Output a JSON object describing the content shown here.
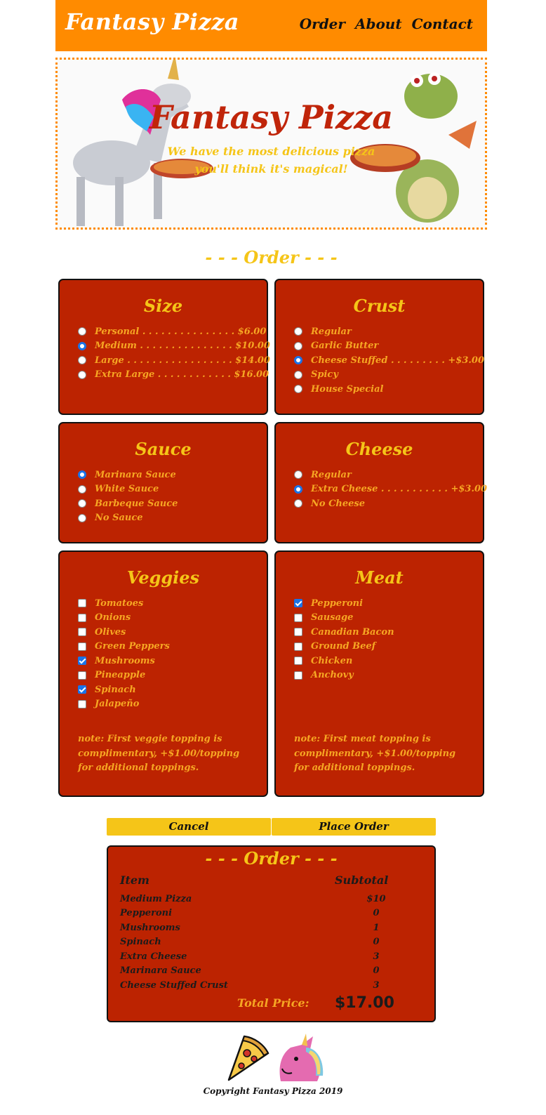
{
  "header": {
    "brand": "Fantasy Pizza",
    "nav": [
      "Order",
      "About",
      "Contact"
    ]
  },
  "hero": {
    "title": "Fantasy Pizza",
    "subtitle_line1": "We have the most delicious pizza",
    "subtitle_line2": "you'll think it's magical!"
  },
  "order_title": "- - - Order - - -",
  "size": {
    "title": "Size",
    "options": [
      {
        "label": "Personal . . . . . . . . . . . . . . . $6.00",
        "selected": false
      },
      {
        "label": "Medium . . . . . . . . . . . . . . . $10.00",
        "selected": true
      },
      {
        "label": "Large . . . . . . . . . . . . . . . . . $14.00",
        "selected": false
      },
      {
        "label": "Extra Large . . . . . . . . . . . . $16.00",
        "selected": false
      }
    ]
  },
  "crust": {
    "title": "Crust",
    "options": [
      {
        "label": "Regular",
        "selected": false
      },
      {
        "label": "Garlic Butter",
        "selected": false
      },
      {
        "label": "Cheese Stuffed . . . . . . . . . +$3.00",
        "selected": true
      },
      {
        "label": "Spicy",
        "selected": false
      },
      {
        "label": "House Special",
        "selected": false
      }
    ]
  },
  "sauce": {
    "title": "Sauce",
    "options": [
      {
        "label": "Marinara Sauce",
        "selected": true
      },
      {
        "label": "White Sauce",
        "selected": false
      },
      {
        "label": "Barbeque Sauce",
        "selected": false
      },
      {
        "label": "No Sauce",
        "selected": false
      }
    ]
  },
  "cheese": {
    "title": "Cheese",
    "options": [
      {
        "label": "Regular",
        "selected": false
      },
      {
        "label": "Extra Cheese . . . . . . . . . . . +$3.00",
        "selected": true
      },
      {
        "label": "No Cheese",
        "selected": false
      }
    ]
  },
  "veggies": {
    "title": "Veggies",
    "options": [
      {
        "label": "Tomatoes",
        "checked": false
      },
      {
        "label": "Onions",
        "checked": false
      },
      {
        "label": "Olives",
        "checked": false
      },
      {
        "label": "Green Peppers",
        "checked": false
      },
      {
        "label": "Mushrooms",
        "checked": true
      },
      {
        "label": "Pineapple",
        "checked": false
      },
      {
        "label": "Spinach",
        "checked": true
      },
      {
        "label": "Jalapeño",
        "checked": false
      }
    ],
    "note": "note: First veggie topping is complimentary, +$1.00/topping for additional toppings."
  },
  "meat": {
    "title": "Meat",
    "options": [
      {
        "label": "Pepperoni",
        "checked": true
      },
      {
        "label": "Sausage",
        "checked": false
      },
      {
        "label": "Canadian Bacon",
        "checked": false
      },
      {
        "label": "Ground Beef",
        "checked": false
      },
      {
        "label": "Chicken",
        "checked": false
      },
      {
        "label": "Anchovy",
        "checked": false
      }
    ],
    "note": "note: First meat topping is complimentary, +$1.00/topping for additional toppings."
  },
  "buttons": {
    "cancel": "Cancel",
    "place_order": "Place Order"
  },
  "summary": {
    "title": "- - - Order - - -",
    "col_item": "Item",
    "col_subtotal": "Subtotal",
    "rows": [
      {
        "item": "Medium Pizza",
        "subtotal": "$10"
      },
      {
        "item": "Pepperoni",
        "subtotal": "0"
      },
      {
        "item": "Mushrooms",
        "subtotal": "1"
      },
      {
        "item": "Spinach",
        "subtotal": "0"
      },
      {
        "item": "Extra Cheese",
        "subtotal": "3"
      },
      {
        "item": "Marinara Sauce",
        "subtotal": "0"
      },
      {
        "item": "Cheese Stuffed Crust",
        "subtotal": "3"
      }
    ],
    "total_label": "Total Price:",
    "total_value": "$17.00"
  },
  "footer": {
    "copyright": "Copyright Fantasy Pizza 2019",
    "icons": [
      "pizza-slice-icon",
      "unicorn-icon"
    ]
  },
  "colors": {
    "header": "#ff8b00",
    "panel": "#bc2301",
    "title_yellow": "#f5c518",
    "label_orange": "#f6a623",
    "hero_red": "#c0250a",
    "radio_blue": "#1a73e8"
  }
}
